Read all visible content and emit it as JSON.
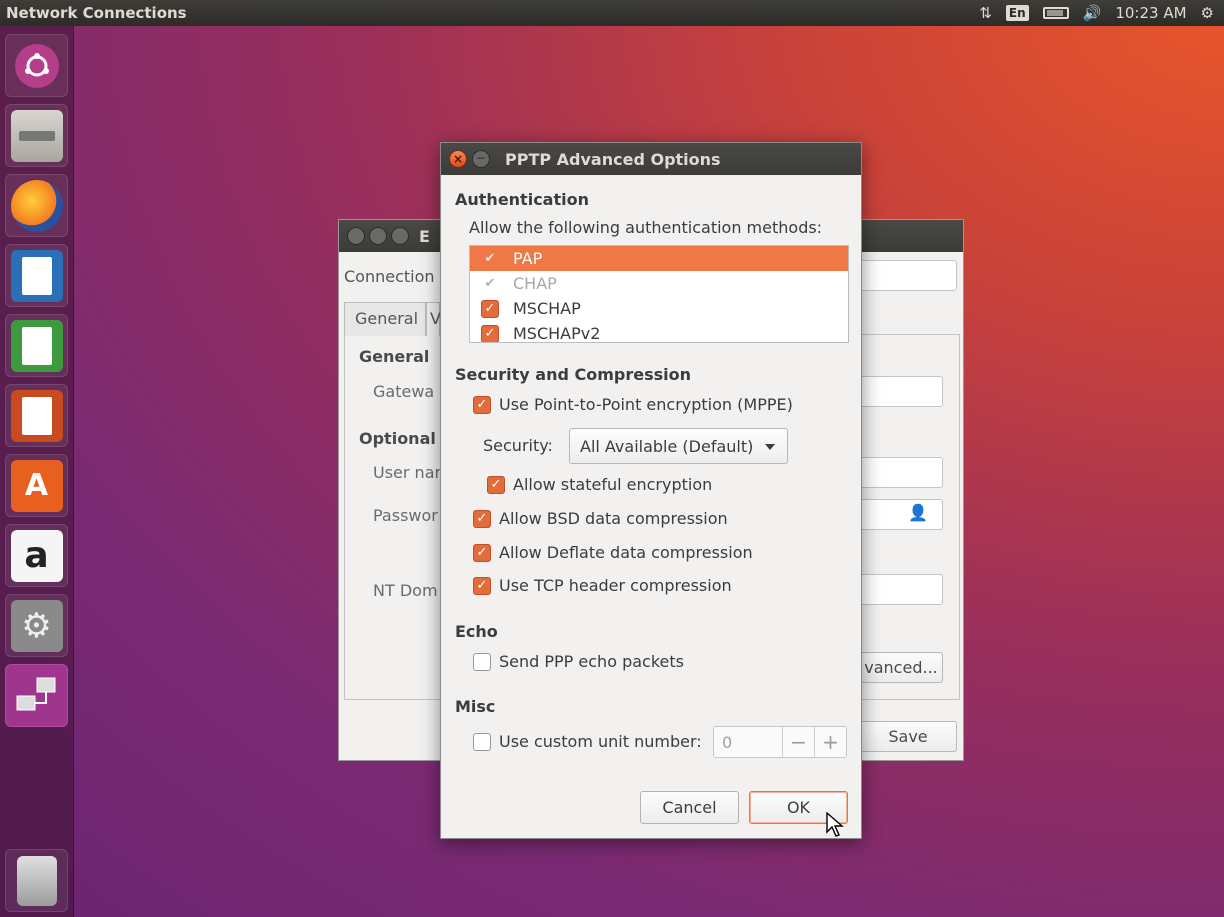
{
  "top_panel": {
    "app_title": "Network Connections",
    "keyboard_layout": "En",
    "clock": "10:23 AM"
  },
  "launcher": {
    "items": [
      "ubuntu-dash",
      "files",
      "firefox",
      "libreoffice-writer",
      "libreoffice-calc",
      "libreoffice-impress",
      "ubuntu-software",
      "amazon",
      "system-settings",
      "network-connections",
      "trash"
    ]
  },
  "background_window": {
    "title_fragment": "E",
    "connection_label": "Connection",
    "tab_general": "General",
    "tab_vpn_fragment": "V",
    "section_general": "General",
    "gateway_label": "Gatewa",
    "section_optional": "Optional",
    "username_label": "User nar",
    "password_label": "Passwor",
    "nt_domain_label": "NT Dom",
    "advanced_button": "vanced...",
    "save_button": "Save"
  },
  "dialog": {
    "title": "PPTP Advanced Options",
    "authentication": {
      "heading": "Authentication",
      "prompt": "Allow the following authentication methods:",
      "methods": [
        {
          "label": "PAP",
          "checked": true,
          "state": "selected"
        },
        {
          "label": "CHAP",
          "checked": true,
          "state": "disabled"
        },
        {
          "label": "MSCHAP",
          "checked": true,
          "state": "normal"
        },
        {
          "label": "MSCHAPv2",
          "checked": true,
          "state": "normal"
        }
      ]
    },
    "security": {
      "heading": "Security and Compression",
      "use_mppe": "Use Point-to-Point encryption (MPPE)",
      "security_label": "Security:",
      "security_value": "All Available (Default)",
      "stateful": "Allow stateful encryption",
      "bsd": "Allow BSD data compression",
      "deflate": "Allow Deflate data compression",
      "tcp_header": "Use TCP header compression"
    },
    "echo": {
      "heading": "Echo",
      "send_echo": "Send PPP echo packets"
    },
    "misc": {
      "heading": "Misc",
      "custom_unit": "Use custom unit number:",
      "unit_value": "0",
      "minus": "−",
      "plus": "+"
    },
    "buttons": {
      "cancel": "Cancel",
      "ok": "OK"
    }
  },
  "colors": {
    "accent": "#e36c3b",
    "selection": "#f07746",
    "panel": "#3c3b37"
  }
}
